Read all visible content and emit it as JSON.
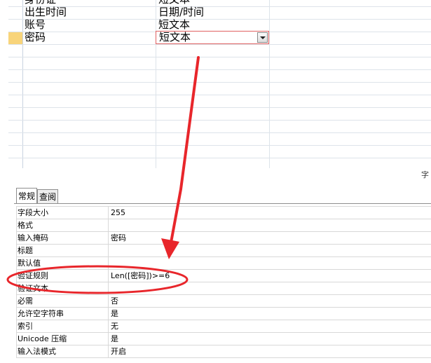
{
  "design_grid": {
    "rows": [
      {
        "field_name": "身份证",
        "data_type": "短文本"
      },
      {
        "field_name": "出生时间",
        "data_type": "日期/时间"
      },
      {
        "field_name": "账号",
        "data_type": "短文本"
      },
      {
        "field_name": "密码",
        "data_type": "短文本"
      }
    ],
    "combo_arrow_icon": "chevron-down-icon",
    "partial_label": "字"
  },
  "properties": {
    "tabs": [
      {
        "label": "常规",
        "active": true
      },
      {
        "label": "查阅",
        "active": false
      }
    ],
    "rows": [
      {
        "label": "字段大小",
        "value": "255"
      },
      {
        "label": "格式",
        "value": ""
      },
      {
        "label": "输入掩码",
        "value": "密码"
      },
      {
        "label": "标题",
        "value": ""
      },
      {
        "label": "默认值",
        "value": ""
      },
      {
        "label": "验证规则",
        "value": "Len([密码])>=6"
      },
      {
        "label": "验证文本",
        "value": ""
      },
      {
        "label": "必需",
        "value": "否"
      },
      {
        "label": "允许空字符串",
        "value": "是"
      },
      {
        "label": "索引",
        "value": "无"
      },
      {
        "label": "Unicode 压缩",
        "value": "是"
      },
      {
        "label": "输入法模式",
        "value": "开启"
      }
    ]
  },
  "colors": {
    "annotation_red": "#e8262b",
    "selector_highlight": "#f8d47a"
  }
}
